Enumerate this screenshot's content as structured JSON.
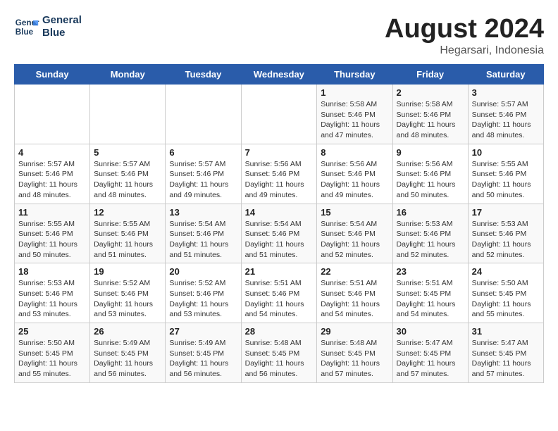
{
  "header": {
    "logo_line1": "General",
    "logo_line2": "Blue",
    "month_title": "August 2024",
    "location": "Hegarsari, Indonesia"
  },
  "weekdays": [
    "Sunday",
    "Monday",
    "Tuesday",
    "Wednesday",
    "Thursday",
    "Friday",
    "Saturday"
  ],
  "weeks": [
    [
      {
        "day": "",
        "sunrise": "",
        "sunset": "",
        "daylight": ""
      },
      {
        "day": "",
        "sunrise": "",
        "sunset": "",
        "daylight": ""
      },
      {
        "day": "",
        "sunrise": "",
        "sunset": "",
        "daylight": ""
      },
      {
        "day": "",
        "sunrise": "",
        "sunset": "",
        "daylight": ""
      },
      {
        "day": "1",
        "sunrise": "5:58 AM",
        "sunset": "5:46 PM",
        "daylight": "11 hours and 47 minutes."
      },
      {
        "day": "2",
        "sunrise": "5:58 AM",
        "sunset": "5:46 PM",
        "daylight": "11 hours and 48 minutes."
      },
      {
        "day": "3",
        "sunrise": "5:57 AM",
        "sunset": "5:46 PM",
        "daylight": "11 hours and 48 minutes."
      }
    ],
    [
      {
        "day": "4",
        "sunrise": "5:57 AM",
        "sunset": "5:46 PM",
        "daylight": "11 hours and 48 minutes."
      },
      {
        "day": "5",
        "sunrise": "5:57 AM",
        "sunset": "5:46 PM",
        "daylight": "11 hours and 48 minutes."
      },
      {
        "day": "6",
        "sunrise": "5:57 AM",
        "sunset": "5:46 PM",
        "daylight": "11 hours and 49 minutes."
      },
      {
        "day": "7",
        "sunrise": "5:56 AM",
        "sunset": "5:46 PM",
        "daylight": "11 hours and 49 minutes."
      },
      {
        "day": "8",
        "sunrise": "5:56 AM",
        "sunset": "5:46 PM",
        "daylight": "11 hours and 49 minutes."
      },
      {
        "day": "9",
        "sunrise": "5:56 AM",
        "sunset": "5:46 PM",
        "daylight": "11 hours and 50 minutes."
      },
      {
        "day": "10",
        "sunrise": "5:55 AM",
        "sunset": "5:46 PM",
        "daylight": "11 hours and 50 minutes."
      }
    ],
    [
      {
        "day": "11",
        "sunrise": "5:55 AM",
        "sunset": "5:46 PM",
        "daylight": "11 hours and 50 minutes."
      },
      {
        "day": "12",
        "sunrise": "5:55 AM",
        "sunset": "5:46 PM",
        "daylight": "11 hours and 51 minutes."
      },
      {
        "day": "13",
        "sunrise": "5:54 AM",
        "sunset": "5:46 PM",
        "daylight": "11 hours and 51 minutes."
      },
      {
        "day": "14",
        "sunrise": "5:54 AM",
        "sunset": "5:46 PM",
        "daylight": "11 hours and 51 minutes."
      },
      {
        "day": "15",
        "sunrise": "5:54 AM",
        "sunset": "5:46 PM",
        "daylight": "11 hours and 52 minutes."
      },
      {
        "day": "16",
        "sunrise": "5:53 AM",
        "sunset": "5:46 PM",
        "daylight": "11 hours and 52 minutes."
      },
      {
        "day": "17",
        "sunrise": "5:53 AM",
        "sunset": "5:46 PM",
        "daylight": "11 hours and 52 minutes."
      }
    ],
    [
      {
        "day": "18",
        "sunrise": "5:53 AM",
        "sunset": "5:46 PM",
        "daylight": "11 hours and 53 minutes."
      },
      {
        "day": "19",
        "sunrise": "5:52 AM",
        "sunset": "5:46 PM",
        "daylight": "11 hours and 53 minutes."
      },
      {
        "day": "20",
        "sunrise": "5:52 AM",
        "sunset": "5:46 PM",
        "daylight": "11 hours and 53 minutes."
      },
      {
        "day": "21",
        "sunrise": "5:51 AM",
        "sunset": "5:46 PM",
        "daylight": "11 hours and 54 minutes."
      },
      {
        "day": "22",
        "sunrise": "5:51 AM",
        "sunset": "5:46 PM",
        "daylight": "11 hours and 54 minutes."
      },
      {
        "day": "23",
        "sunrise": "5:51 AM",
        "sunset": "5:45 PM",
        "daylight": "11 hours and 54 minutes."
      },
      {
        "day": "24",
        "sunrise": "5:50 AM",
        "sunset": "5:45 PM",
        "daylight": "11 hours and 55 minutes."
      }
    ],
    [
      {
        "day": "25",
        "sunrise": "5:50 AM",
        "sunset": "5:45 PM",
        "daylight": "11 hours and 55 minutes."
      },
      {
        "day": "26",
        "sunrise": "5:49 AM",
        "sunset": "5:45 PM",
        "daylight": "11 hours and 56 minutes."
      },
      {
        "day": "27",
        "sunrise": "5:49 AM",
        "sunset": "5:45 PM",
        "daylight": "11 hours and 56 minutes."
      },
      {
        "day": "28",
        "sunrise": "5:48 AM",
        "sunset": "5:45 PM",
        "daylight": "11 hours and 56 minutes."
      },
      {
        "day": "29",
        "sunrise": "5:48 AM",
        "sunset": "5:45 PM",
        "daylight": "11 hours and 57 minutes."
      },
      {
        "day": "30",
        "sunrise": "5:47 AM",
        "sunset": "5:45 PM",
        "daylight": "11 hours and 57 minutes."
      },
      {
        "day": "31",
        "sunrise": "5:47 AM",
        "sunset": "5:45 PM",
        "daylight": "11 hours and 57 minutes."
      }
    ]
  ]
}
